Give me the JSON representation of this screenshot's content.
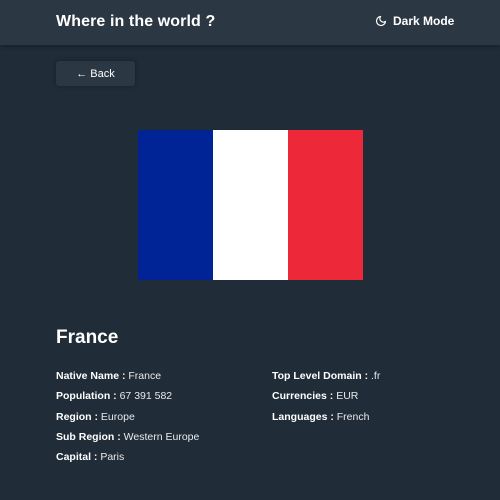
{
  "header": {
    "title": "Where in the world ?",
    "mode_toggle_label": "Dark Mode",
    "mode_icon": "moon-icon"
  },
  "back": {
    "label": "Back",
    "arrow": "←",
    "icon": "arrow-left-icon"
  },
  "flag": {
    "description_colors": [
      "#002395",
      "#ffffff",
      "#ed2939"
    ]
  },
  "country": {
    "name": "France",
    "details_left": [
      {
        "label": "Native Name :",
        "value": "France"
      },
      {
        "label": "Population :",
        "value": "67 391 582"
      },
      {
        "label": "Region :",
        "value": "Europe"
      },
      {
        "label": "Sub Region :",
        "value": "Western Europe"
      },
      {
        "label": "Capital :",
        "value": "Paris"
      }
    ],
    "details_right": [
      {
        "label": "Top Level Domain :",
        "value": ".fr"
      },
      {
        "label": "Currencies :",
        "value": "EUR"
      },
      {
        "label": "Languages :",
        "value": "French"
      }
    ]
  },
  "colors": {
    "background": "#202c37",
    "elements": "#2b3743",
    "text": "#ffffff"
  }
}
